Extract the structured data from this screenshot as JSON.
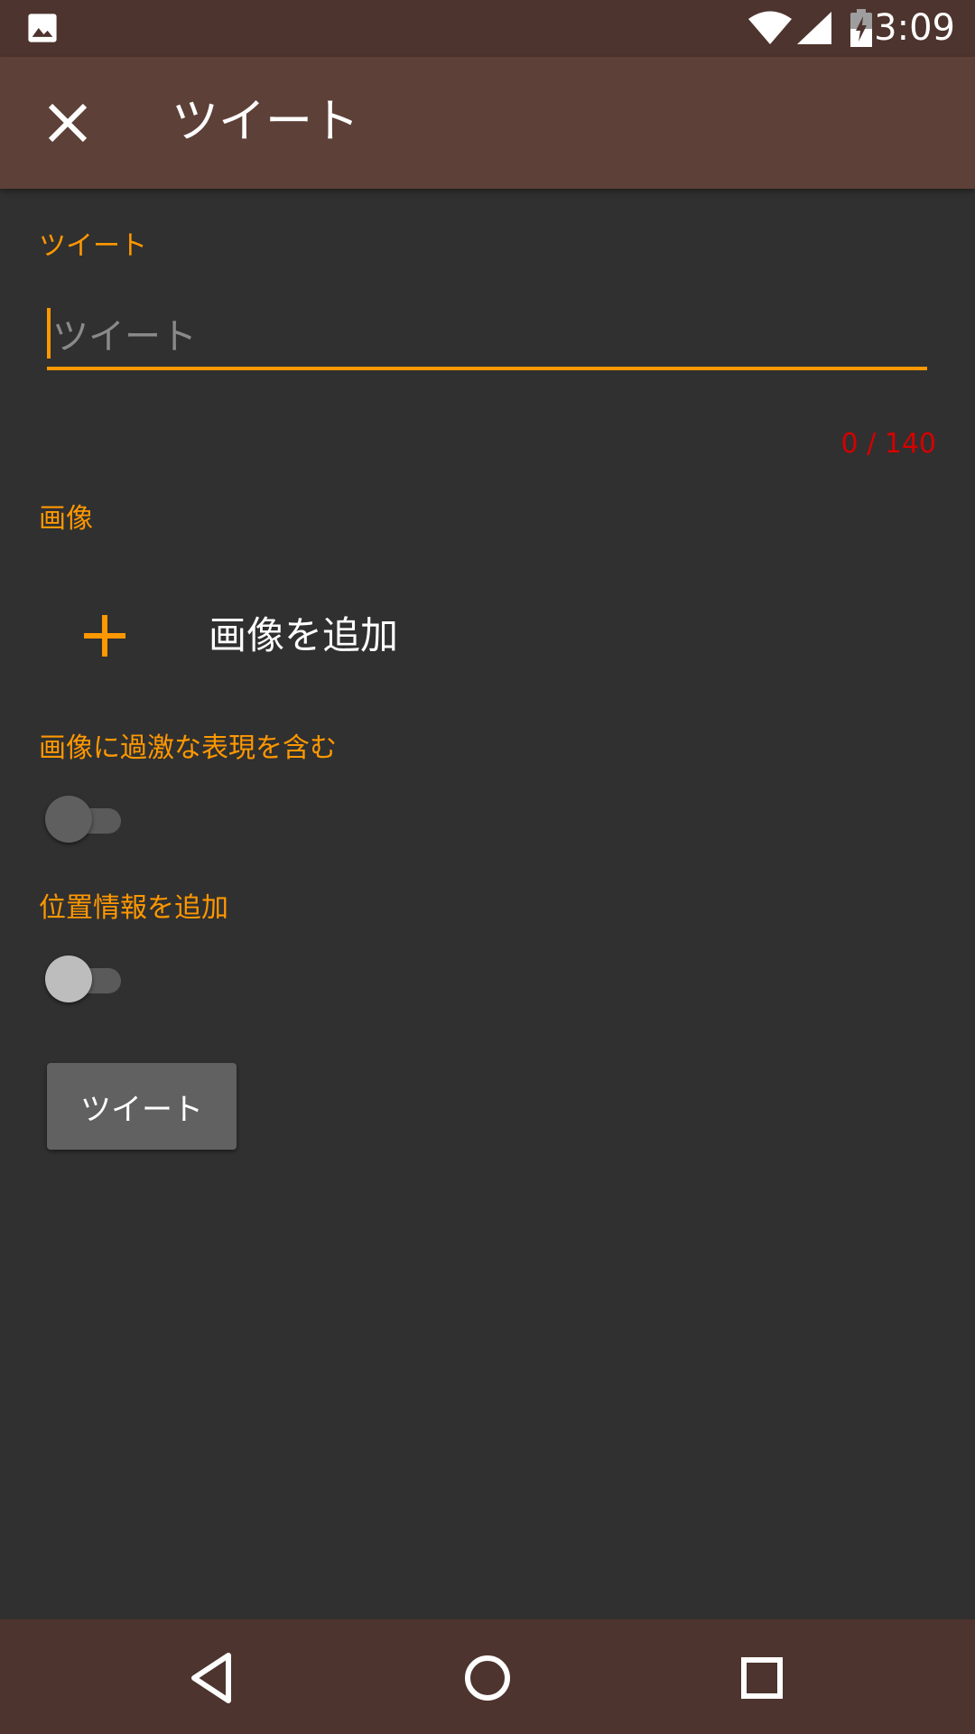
{
  "status_bar": {
    "time": "3:09",
    "left_icon": "image-icon",
    "icons": [
      "wifi-icon",
      "cellular-signal-icon",
      "battery-charging-icon"
    ]
  },
  "toolbar": {
    "close_icon": "close-icon",
    "title": "ツイート"
  },
  "form": {
    "tweet_section_label": "ツイート",
    "tweet_input": {
      "value": "",
      "placeholder": "ツイート"
    },
    "char_counter": "0 / 140",
    "image_section_label": "画像",
    "add_image_label": "画像を追加",
    "sensitive_label": "画像に過激な表現を含む",
    "sensitive_on": false,
    "location_label": "位置情報を追加",
    "location_on": false,
    "submit_label": "ツイート"
  },
  "nav_bar": {
    "buttons": [
      "back-icon",
      "home-icon",
      "recents-icon"
    ]
  },
  "colors": {
    "status_bar": "#4e342e",
    "toolbar": "#5d4037",
    "background": "#303030",
    "accent": "#ff9800",
    "counter": "#d50000",
    "button": "#616161"
  }
}
